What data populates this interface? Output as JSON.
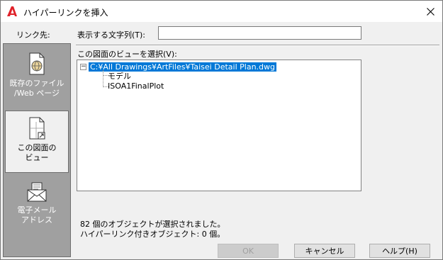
{
  "window": {
    "title": "ハイパーリンクを挿入"
  },
  "sidebar": {
    "heading": "リンク先:",
    "items": [
      {
        "label_line1": "既存のファイル",
        "label_line2": "/Web ページ",
        "icon": "existing-file-icon",
        "active": false
      },
      {
        "label_line1": "この図面の",
        "label_line2": "ビュー",
        "icon": "drawing-view-icon",
        "active": true
      },
      {
        "label_line1": "電子メール",
        "label_line2": "アドレス",
        "icon": "email-icon",
        "active": false
      }
    ]
  },
  "display": {
    "label": "表示する文字列(T):",
    "value": ""
  },
  "view_select": {
    "label": "この図面のビューを選択(V):",
    "tree": {
      "root": "C:¥All Drawings¥ArtFiles¥Taisei Detail Plan.dwg",
      "expander": "−",
      "children": [
        "モデル",
        "ISOA1FinalPlot"
      ]
    }
  },
  "status": {
    "selected": "82 個のオブジェクトが選択されました。",
    "hyperlinked": "ハイパーリンク付きオブジェクト: 0 個。"
  },
  "buttons": {
    "ok": "OK",
    "cancel": "キャンセル",
    "help": "ヘルプ(H)"
  },
  "colors": {
    "selection": "#0078d7",
    "sidebar": "#a0a0a0",
    "app_icon": "#e0222a"
  }
}
